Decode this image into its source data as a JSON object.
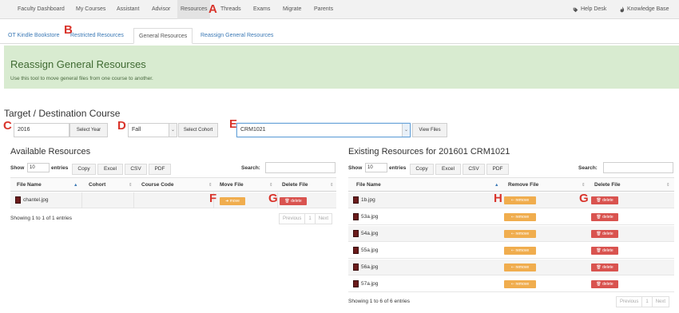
{
  "topnav": {
    "items": [
      "Faculty Dashboard",
      "My Courses",
      "Assistant",
      "Advisor",
      "Resources",
      "Threads",
      "Exams",
      "Migrate",
      "Parents"
    ],
    "active": "Resources",
    "help_desk": "Help Desk",
    "knowledge_base": "Knowledge Base"
  },
  "subtabs": [
    "OT Kindle Bookstore",
    "Restricted Resources",
    "General Resources",
    "Reassign General Resources"
  ],
  "banner": {
    "title": "Reassign General Resourses",
    "text": "Use this tool to move general files from one course to another."
  },
  "target": {
    "title": "Target / Destination Course",
    "year_value": "2016",
    "select_year": "Select Year",
    "term_value": "Fall",
    "select_cohort": "Select Cohort",
    "course_value": "CRM1021",
    "view_files": "View Files"
  },
  "available": {
    "title": "Available Resources",
    "show": "Show",
    "entries_value": "10",
    "entries": "entries",
    "buttons": [
      "Copy",
      "Excel",
      "CSV",
      "PDF"
    ],
    "search": "Search:",
    "headers": [
      "File Name",
      "Cohort",
      "Course Code",
      "Move File",
      "Delete File"
    ],
    "rows": [
      {
        "file": "chantel.jpg",
        "move": "move",
        "delete": "delete"
      }
    ],
    "info": "Showing 1 to 1 of 1 entries",
    "pager": [
      "Previous",
      "1",
      "Next"
    ]
  },
  "existing": {
    "title": "Existing Resources for 201601 CRM1021",
    "show": "Show",
    "entries_value": "10",
    "entries": "entries",
    "buttons": [
      "Copy",
      "Excel",
      "CSV",
      "PDF"
    ],
    "search": "Search:",
    "headers": [
      "File Name",
      "Remove File",
      "Delete File"
    ],
    "rows": [
      {
        "file": "1b.jpg",
        "remove": "remove",
        "delete": "delete"
      },
      {
        "file": "53a.jpg",
        "remove": "remove",
        "delete": "delete"
      },
      {
        "file": "54a.jpg",
        "remove": "remove",
        "delete": "delete"
      },
      {
        "file": "55a.jpg",
        "remove": "remove",
        "delete": "delete"
      },
      {
        "file": "56a.jpg",
        "remove": "remove",
        "delete": "delete"
      },
      {
        "file": "57a.jpg",
        "remove": "remove",
        "delete": "delete"
      }
    ],
    "info": "Showing 1 to 6 of 6 entries",
    "pager": [
      "Previous",
      "1",
      "Next"
    ]
  },
  "annotations": [
    "A",
    "B",
    "C",
    "D",
    "E",
    "F",
    "G",
    "G",
    "H"
  ],
  "colors": {
    "banner_bg": "#d8ebd0",
    "move_button": "#f0ad4e",
    "delete_button": "#d9534f",
    "annotation": "#d9342b",
    "link": "#3a78b5"
  }
}
